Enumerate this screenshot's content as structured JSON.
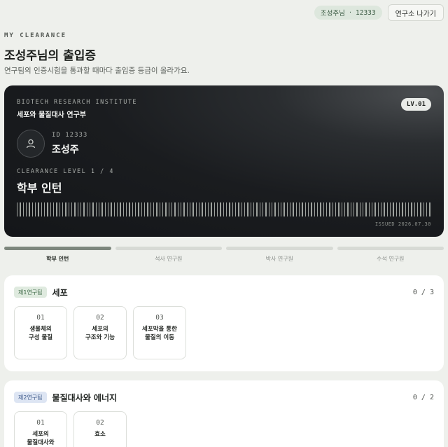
{
  "header": {
    "user_name": "조성주님",
    "separator": "·",
    "user_id": "12333",
    "exit_label": "연구소 나가기"
  },
  "intro": {
    "eyebrow": "MY CLEARANCE",
    "title": "조성주님의 출입증",
    "subtitle": "연구팀의 인증시험을 통과할 때마다 출입증 등급이 올라가요."
  },
  "card": {
    "institute": "BIOTECH RESEARCH INSTITUTE",
    "department": "세포와 물질대사 연구부",
    "level_badge": "LV.01",
    "id_label": "ID 12333",
    "name": "조성주",
    "level_label": "CLEARANCE LEVEL 1 / 4",
    "level_name": "학부 인턴",
    "issued": "ISSUED 2026.07.30"
  },
  "progress": {
    "current_step": 1,
    "steps": [
      {
        "label": "학부 인턴"
      },
      {
        "label": "석사 연구원"
      },
      {
        "label": "박사 연구원"
      },
      {
        "label": "수석 연구원"
      }
    ]
  },
  "sections": [
    {
      "team": "제1연구팀",
      "title": "세포",
      "count": "0 / 3",
      "lessons": [
        {
          "num": "01",
          "title": "생물체의\n구성 물질"
        },
        {
          "num": "02",
          "title": "세포의\n구조와 기능"
        },
        {
          "num": "03",
          "title": "세포막을 통한\n물질의 이동"
        }
      ]
    },
    {
      "team": "제2연구팀",
      "title": "물질대사와 에너지",
      "count": "0 / 2",
      "lessons": [
        {
          "num": "01",
          "title": "세포의\n물질대사와"
        },
        {
          "num": "02",
          "title": "효소"
        }
      ]
    }
  ],
  "colors": {
    "background": "#eef0ec",
    "card_dark": "#1a1c1f",
    "accent_green": "#7d877d",
    "team1_badge": "#dfeadf",
    "team2_badge": "#dde5f3"
  }
}
